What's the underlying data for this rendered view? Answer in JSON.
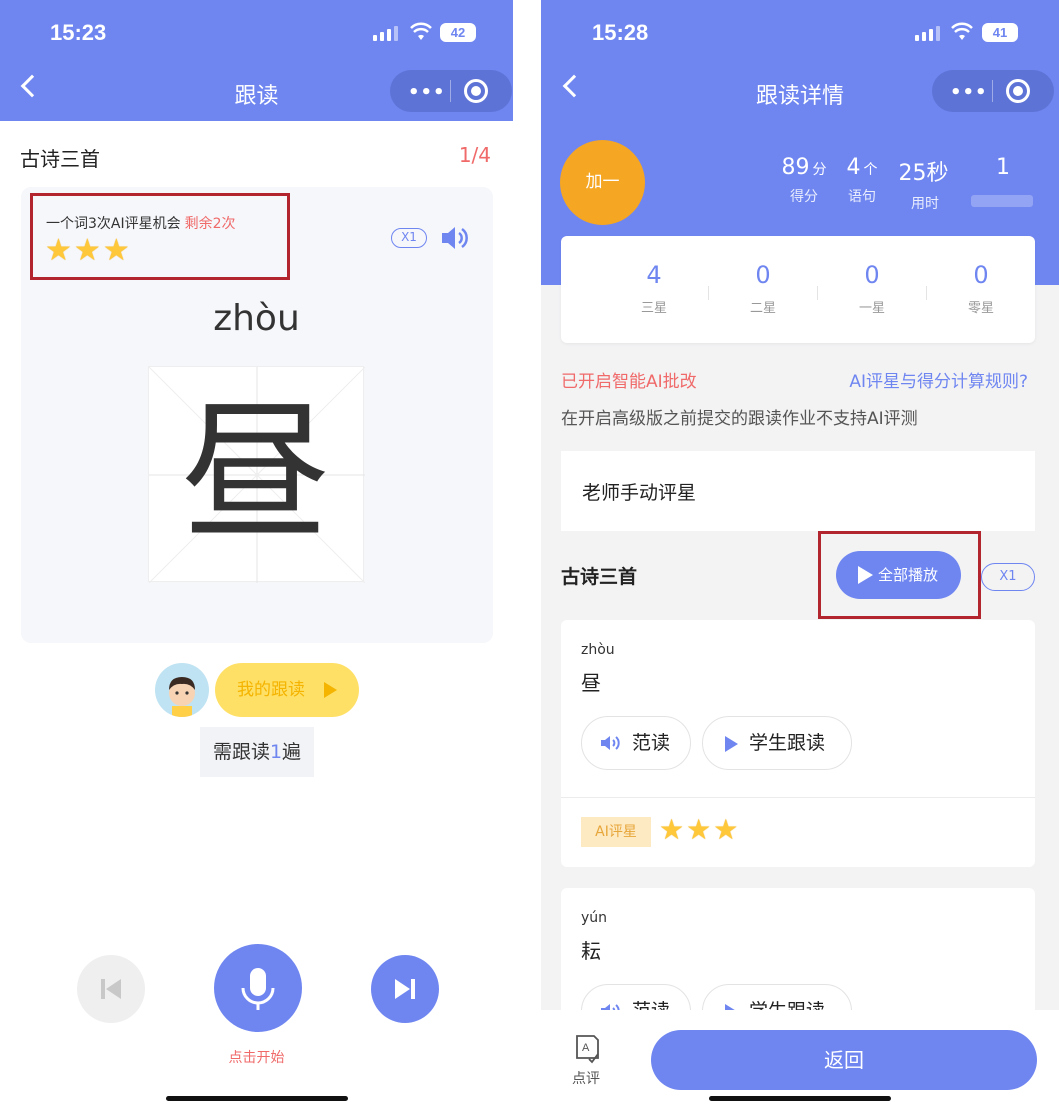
{
  "left": {
    "status": {
      "time": "15:23",
      "battery": "42"
    },
    "nav": {
      "title": "跟读"
    },
    "lesson_title": "古诗三首",
    "progress": "1/4",
    "chance": {
      "text": "一个词3次AI评星机会",
      "remaining": "剩余2次",
      "stars": 3
    },
    "speed": "X1",
    "pinyin": "zhòu",
    "character": "昼",
    "my_read_label": "我的跟读",
    "need_read": {
      "prefix": "需跟读",
      "count": "1",
      "suffix": "遍"
    },
    "start_label": "点击开始"
  },
  "right": {
    "status": {
      "time": "15:28",
      "battery": "41"
    },
    "nav": {
      "title": "跟读详情"
    },
    "student_badge": "加一",
    "stats": [
      {
        "value": "89",
        "unit": "分",
        "label": "得分"
      },
      {
        "value": "4",
        "unit": "个",
        "label": "语句"
      },
      {
        "value": "25秒",
        "unit": "",
        "label": "用时"
      },
      {
        "value": "1",
        "unit": "",
        "label": ""
      }
    ],
    "star_counts": [
      {
        "value": "4",
        "label": "三星"
      },
      {
        "value": "0",
        "label": "二星"
      },
      {
        "value": "0",
        "label": "一星"
      },
      {
        "value": "0",
        "label": "零星"
      }
    ],
    "ai_enabled": "已开启智能AI批改",
    "ai_rules": "AI评星与得分计算规则?",
    "notice": "在开启高级版之前提交的跟读作业不支持AI评测",
    "manual_rating": "老师手动评星",
    "section_title": "古诗三首",
    "play_all": "全部播放",
    "speed": "X1",
    "words": [
      {
        "pinyin": "zhòu",
        "char": "昼",
        "sample": "范读",
        "student": "学生跟读",
        "ai_tag": "AI评星",
        "stars": 3
      },
      {
        "pinyin": "yún",
        "char": "耘",
        "sample": "范读",
        "student": "学生跟读"
      }
    ],
    "review_label": "点评",
    "return_label": "返回"
  },
  "colors": {
    "primary": "#6f86f1",
    "accent_red": "#f06a6a",
    "star": "#ffc83a",
    "badge_orange": "#f5a623",
    "highlight_box": "#b3252e"
  },
  "icons": [
    "back-icon",
    "more-icon",
    "target-icon",
    "speaker-icon",
    "mic-icon",
    "prev-icon",
    "next-icon",
    "play-icon",
    "review-icon",
    "signal-icon",
    "wifi-icon",
    "battery-icon",
    "star-icon"
  ]
}
